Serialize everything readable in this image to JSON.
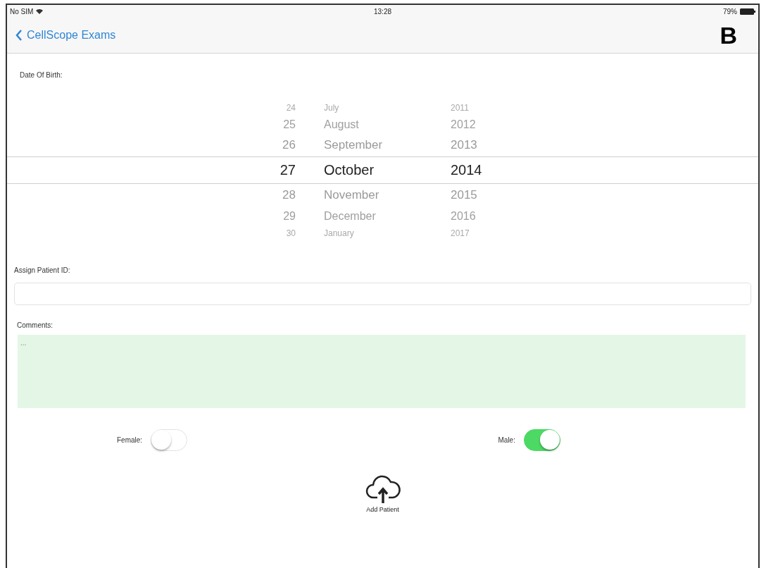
{
  "status_bar": {
    "carrier": "No SIM",
    "time": "13:28",
    "battery": "79%"
  },
  "nav": {
    "back_label": "CellScope Exams",
    "panel_label": "B"
  },
  "date_of_birth": {
    "label": "Date Of Birth:",
    "rows": [
      {
        "day": "24",
        "month": "July",
        "year": "2011",
        "selected": false
      },
      {
        "day": "25",
        "month": "August",
        "year": "2012",
        "selected": false
      },
      {
        "day": "26",
        "month": "September",
        "year": "2013",
        "selected": false
      },
      {
        "day": "27",
        "month": "October",
        "year": "2014",
        "selected": true
      },
      {
        "day": "28",
        "month": "November",
        "year": "2015",
        "selected": false
      },
      {
        "day": "29",
        "month": "December",
        "year": "2016",
        "selected": false
      },
      {
        "day": "30",
        "month": "January",
        "year": "2017",
        "selected": false
      }
    ]
  },
  "patient_id": {
    "label": "Assign Patient ID:"
  },
  "comments": {
    "label": "Comments:",
    "value": "..."
  },
  "toggles": [
    {
      "label": "Female:",
      "on": false
    },
    {
      "label": "Male:",
      "on": true
    }
  ],
  "add_button": {
    "label": "Add Patient"
  }
}
